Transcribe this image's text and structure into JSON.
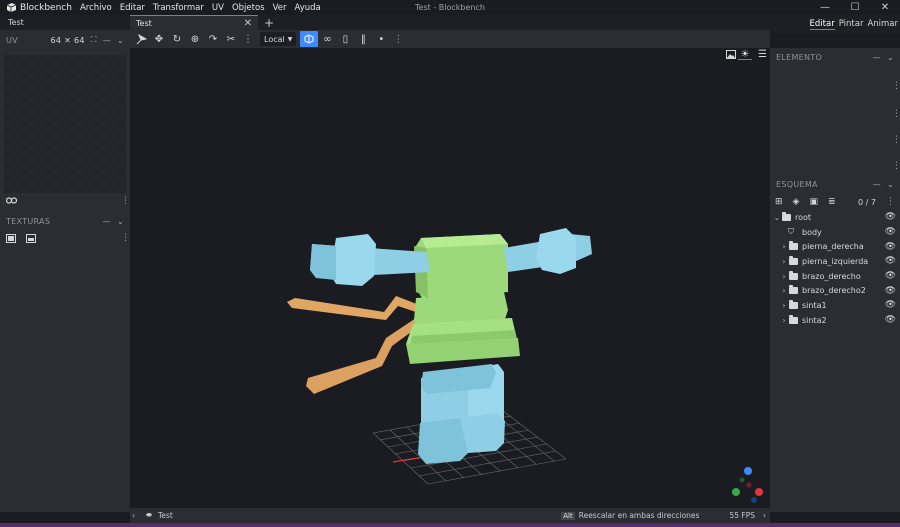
{
  "titlebar": {
    "app_name": "Blockbench",
    "menus": [
      "Archivo",
      "Editar",
      "Transformar",
      "UV",
      "Objetos",
      "Ver",
      "Ayuda"
    ],
    "window_title": "Test - Blockbench",
    "controls": [
      "—",
      "☐",
      "✕"
    ]
  },
  "left": {
    "tab_label": "Test",
    "uv_panel": {
      "title": "UV",
      "size": "64 ✕ 64"
    },
    "textures_panel": {
      "title": "TEXTURAS"
    }
  },
  "center": {
    "tab_label": "Test",
    "tab_close": "✕",
    "new_tab": "+",
    "space_select": "Local",
    "view_icons": [
      "image-icon",
      "sun-icon",
      "menu-icon"
    ]
  },
  "right": {
    "modes": [
      "Editar",
      "Pintar",
      "Animar"
    ],
    "active_mode": "Editar",
    "element_panel": {
      "title": "ELEMENTO"
    },
    "outliner": {
      "title": "ESQUEMA",
      "count": "0 / 7",
      "items": [
        {
          "name": "root",
          "type": "group",
          "depth": 0,
          "expanded": true
        },
        {
          "name": "body",
          "type": "locator",
          "depth": 1
        },
        {
          "name": "pierna_derecha",
          "type": "group",
          "depth": 1
        },
        {
          "name": "pierna_izquierda",
          "type": "group",
          "depth": 1
        },
        {
          "name": "brazo_derecho",
          "type": "group",
          "depth": 1
        },
        {
          "name": "brazo_derecho2",
          "type": "group",
          "depth": 1
        },
        {
          "name": "sinta1",
          "type": "group",
          "depth": 1
        },
        {
          "name": "sinta2",
          "type": "group",
          "depth": 1
        }
      ]
    }
  },
  "status": {
    "project": "Test",
    "key_hint": "Alt",
    "hint_text": "Reescalar en ambas direcciones",
    "fps": "55 FPS"
  },
  "colors": {
    "accent": "#3e8bff",
    "model_green": "#9bd97a",
    "model_blue": "#8ed0ea",
    "model_orange": "#e3a864"
  }
}
